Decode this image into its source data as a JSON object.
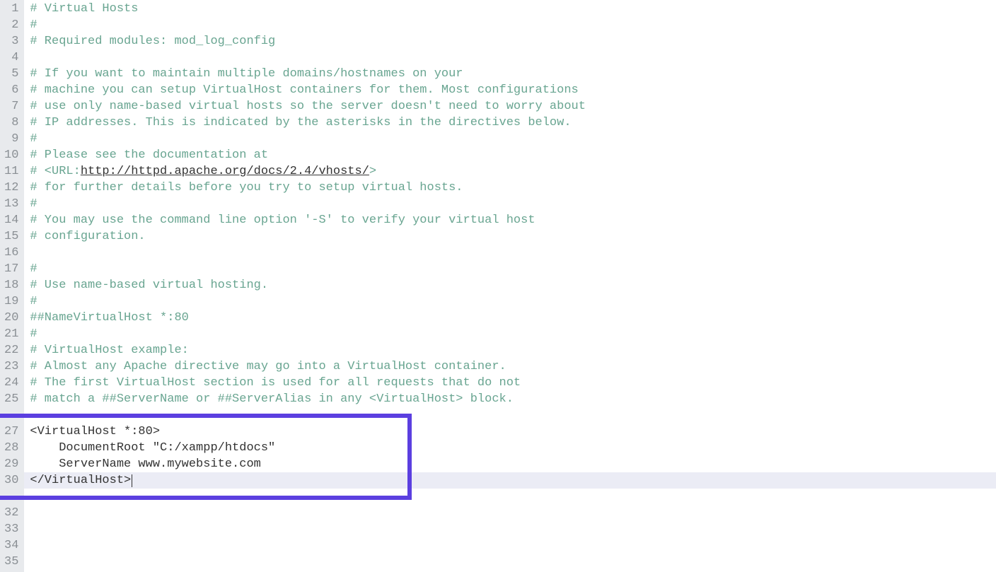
{
  "line_count": 35,
  "lines": {
    "1": {
      "text": "# Virtual Hosts",
      "kind": "comment"
    },
    "2": {
      "text": "#",
      "kind": "comment"
    },
    "3": {
      "text": "# Required modules: mod_log_config",
      "kind": "comment"
    },
    "4": {
      "text": "",
      "kind": "blank"
    },
    "5": {
      "text": "# If you want to maintain multiple domains/hostnames on your",
      "kind": "comment"
    },
    "6": {
      "text": "# machine you can setup VirtualHost containers for them. Most configurations",
      "kind": "comment"
    },
    "7": {
      "text": "# use only name-based virtual hosts so the server doesn't need to worry about",
      "kind": "comment"
    },
    "8": {
      "text": "# IP addresses. This is indicated by the asterisks in the directives below.",
      "kind": "comment"
    },
    "9": {
      "text": "#",
      "kind": "comment"
    },
    "10": {
      "text": "# Please see the documentation at",
      "kind": "comment"
    },
    "11": {
      "prefix": "# <URL:",
      "url": "http://httpd.apache.org/docs/2.4/vhosts/",
      "suffix": ">",
      "kind": "url"
    },
    "12": {
      "text": "# for further details before you try to setup virtual hosts.",
      "kind": "comment"
    },
    "13": {
      "text": "#",
      "kind": "comment"
    },
    "14": {
      "text": "# You may use the command line option '-S' to verify your virtual host",
      "kind": "comment"
    },
    "15": {
      "text": "# configuration.",
      "kind": "comment"
    },
    "16": {
      "text": "",
      "kind": "blank"
    },
    "17": {
      "text": "#",
      "kind": "comment"
    },
    "18": {
      "text": "# Use name-based virtual hosting.",
      "kind": "comment"
    },
    "19": {
      "text": "#",
      "kind": "comment"
    },
    "20": {
      "text": "##NameVirtualHost *:80",
      "kind": "comment"
    },
    "21": {
      "text": "#",
      "kind": "comment"
    },
    "22": {
      "text": "# VirtualHost example:",
      "kind": "comment"
    },
    "23": {
      "text": "# Almost any Apache directive may go into a VirtualHost container.",
      "kind": "comment"
    },
    "24": {
      "text": "# The first VirtualHost section is used for all requests that do not",
      "kind": "comment"
    },
    "25": {
      "text": "# match a ##ServerName or ##ServerAlias in any <VirtualHost> block.",
      "kind": "comment"
    },
    "26": {
      "text": "#",
      "kind": "comment"
    },
    "27": {
      "text": "<VirtualHost *:80>",
      "kind": "plain"
    },
    "28": {
      "text": "    DocumentRoot \"C:/xampp/htdocs\"",
      "kind": "plain"
    },
    "29": {
      "text": "    ServerName www.mywebsite.com",
      "kind": "plain"
    },
    "30": {
      "text": "</VirtualHost>",
      "kind": "plain-current"
    },
    "31": {
      "text": "",
      "kind": "blank"
    },
    "32": {
      "text": "",
      "kind": "blank"
    },
    "33": {
      "text": "",
      "kind": "blank"
    },
    "34": {
      "text": "",
      "kind": "blank"
    },
    "35": {
      "text": "",
      "kind": "blank"
    }
  },
  "highlight_lines": [
    27,
    30
  ],
  "current_line": 30
}
